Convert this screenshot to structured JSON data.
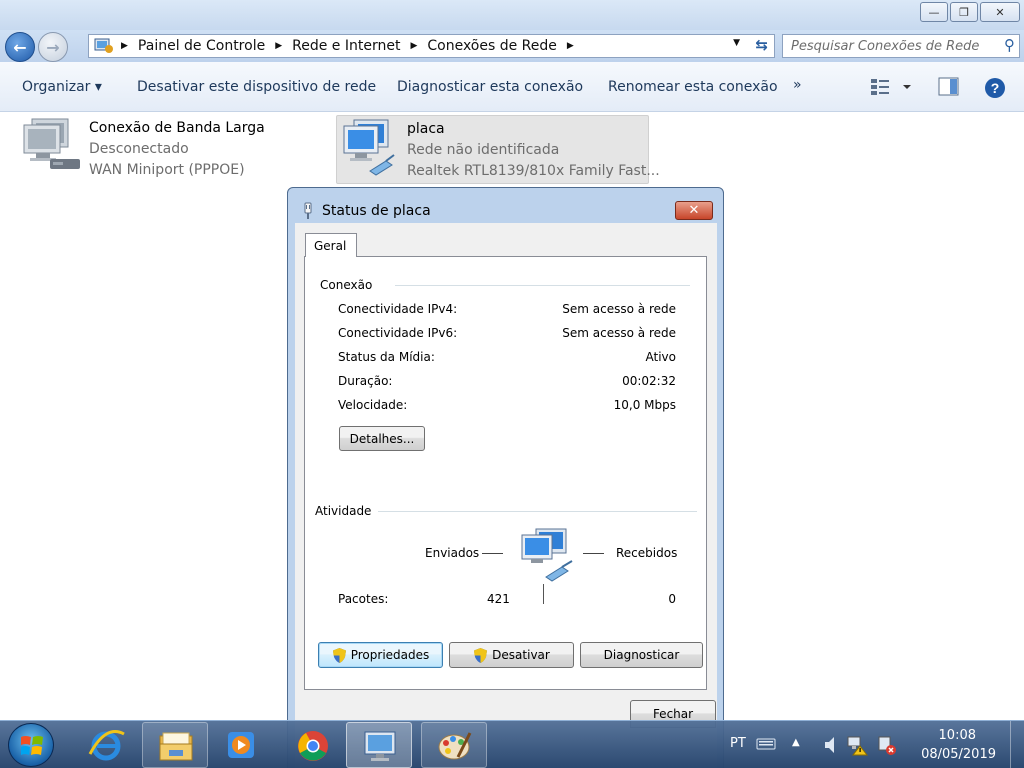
{
  "window": {
    "caption": {
      "minimize": "—",
      "maximize": "❐",
      "close": "✕"
    },
    "address": {
      "crumbs": [
        "Painel de Controle",
        "Rede e Internet",
        "Conexões de Rede"
      ],
      "search_placeholder": "Pesquisar Conexões de Rede"
    },
    "toolbar": {
      "organize": "Organizar ▾",
      "disable": "Desativar este dispositivo de rede",
      "diagnose": "Diagnosticar esta conexão",
      "rename": "Renomear esta conexão",
      "more": "»"
    },
    "connections": [
      {
        "name": "Conexão de Banda Larga",
        "status": "Desconectado",
        "device": "WAN Miniport (PPPOE)"
      },
      {
        "name": "placa",
        "status": "Rede não identificada",
        "device": "Realtek RTL8139/810x Family Fast..."
      }
    ]
  },
  "dialog": {
    "title": "Status de placa",
    "tab": "Geral",
    "connection_group": "Conexão",
    "rows": [
      {
        "label": "Conectividade IPv4:",
        "value": "Sem acesso à rede"
      },
      {
        "label": "Conectividade IPv6:",
        "value": "Sem acesso à rede"
      },
      {
        "label": "Status da Mídia:",
        "value": "Ativo"
      },
      {
        "label": "Duração:",
        "value": "00:02:32"
      },
      {
        "label": "Velocidade:",
        "value": "10,0 Mbps"
      }
    ],
    "details_button": "Detalhes...",
    "activity_group": "Atividade",
    "sent_label": "Enviados",
    "received_label": "Recebidos",
    "packets_label": "Pacotes:",
    "packets_sent": "421",
    "packets_received": "0",
    "properties_button": "Propriedades",
    "disable_button": "Desativar",
    "diagnose_button": "Diagnosticar",
    "close_button": "Fechar"
  },
  "taskbar": {
    "language": "PT",
    "time": "10:08",
    "date": "08/05/2019"
  }
}
